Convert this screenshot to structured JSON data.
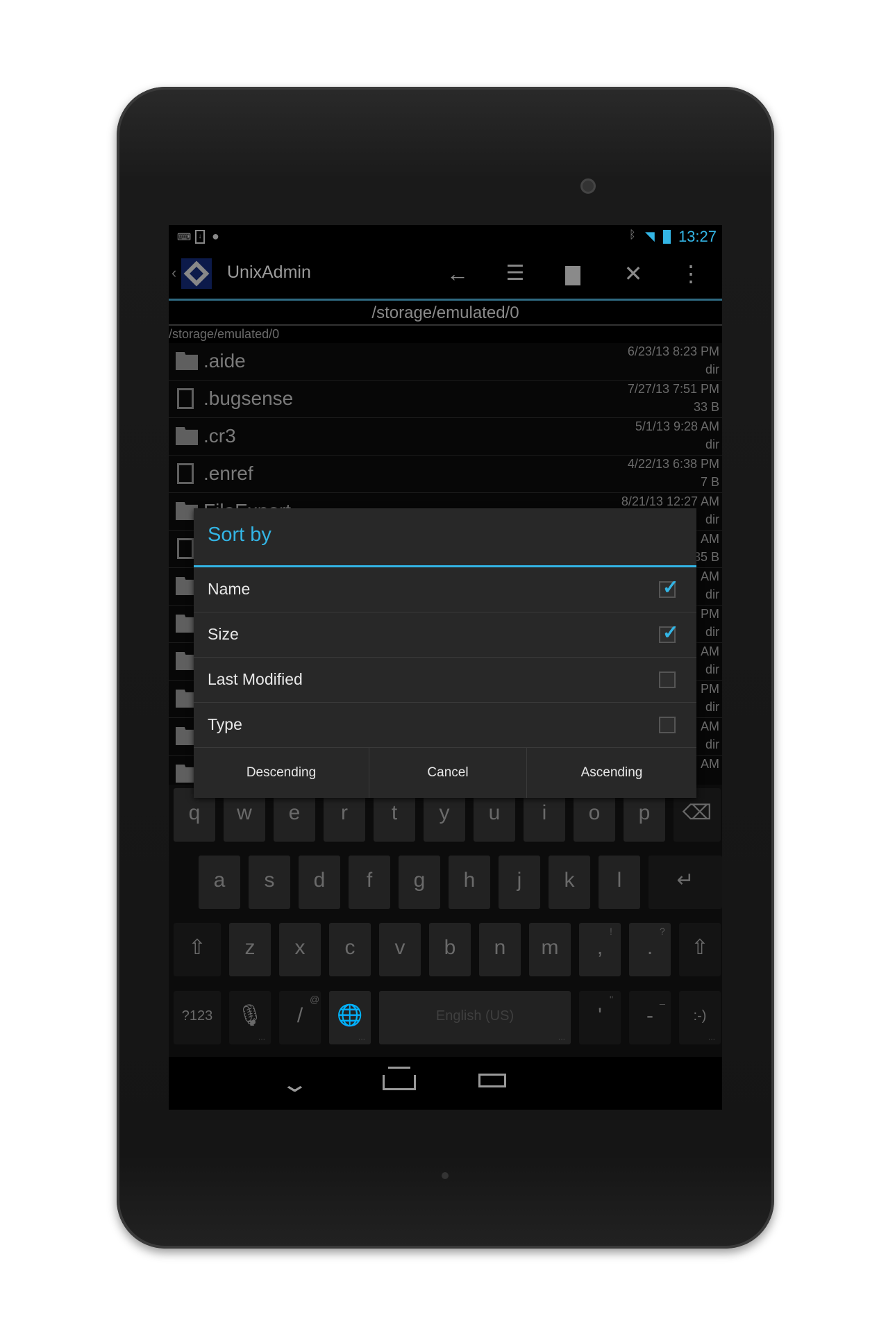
{
  "status_bar": {
    "time": "13:27",
    "left_icons": [
      "keyboard-icon",
      "download-icon",
      "android-icon"
    ],
    "right_icons": [
      "bluetooth-icon",
      "wifi-icon",
      "battery-charging-icon"
    ]
  },
  "action_bar": {
    "title": "UnixAdmin",
    "actions": [
      "back-arrow-icon",
      "sort-icon",
      "new-file-icon",
      "close-icon",
      "overflow-menu-icon"
    ]
  },
  "path_header": "/storage/emulated/0",
  "breadcrumb_path": "/storage/emulated/0",
  "files": [
    {
      "name": ".aide",
      "type": "folder",
      "date": "6/23/13 8:23 PM",
      "size": "dir"
    },
    {
      "name": ".bugsense",
      "type": "file",
      "date": "7/27/13 7:51 PM",
      "size": "33 B"
    },
    {
      "name": ".cr3",
      "type": "folder",
      "date": "5/1/13 9:28 AM",
      "size": "dir"
    },
    {
      "name": ".enref",
      "type": "file",
      "date": "4/22/13 6:38 PM",
      "size": "7 B"
    },
    {
      "name": "FileExpert",
      "type": "folder",
      "date": "8/21/13 12:27 AM",
      "size": "dir"
    },
    {
      "name": "",
      "type": "file",
      "date": "AM",
      "size": "35 B"
    },
    {
      "name": "",
      "type": "folder",
      "date": "AM",
      "size": "dir"
    },
    {
      "name": "",
      "type": "folder",
      "date": "PM",
      "size": "dir"
    },
    {
      "name": "",
      "type": "folder",
      "date": "AM",
      "size": "dir"
    },
    {
      "name": "",
      "type": "folder",
      "date": "PM",
      "size": "dir"
    },
    {
      "name": "",
      "type": "folder",
      "date": "AM",
      "size": "dir"
    },
    {
      "name": "",
      "type": "folder",
      "date": "AM",
      "size": ""
    }
  ],
  "dialog": {
    "title": "Sort by",
    "options": [
      {
        "label": "Name",
        "checked": true
      },
      {
        "label": "Size",
        "checked": true
      },
      {
        "label": "Last Modified",
        "checked": false
      },
      {
        "label": "Type",
        "checked": false
      }
    ],
    "buttons": {
      "descending": "Descending",
      "cancel": "Cancel",
      "ascending": "Ascending"
    }
  },
  "keyboard": {
    "row1": [
      "q",
      "w",
      "e",
      "r",
      "t",
      "y",
      "u",
      "i",
      "o",
      "p"
    ],
    "row2": [
      "a",
      "s",
      "d",
      "f",
      "g",
      "h",
      "j",
      "k",
      "l"
    ],
    "row3": [
      "z",
      "x",
      "c",
      "v",
      "b",
      "n",
      "m",
      ",",
      "."
    ],
    "row3_hints": [
      "",
      "",
      "",
      "",
      "",
      "",
      "",
      "!",
      "?"
    ],
    "symbols_key": "?123",
    "slash_key": "/",
    "slash_hint": "@",
    "space_label": "English (US)",
    "apostrophe_key": "'",
    "apostrophe_hint": "\"",
    "dash_key": "-",
    "dash_hint": "_",
    "smiley_key": ":-)"
  },
  "colors": {
    "accent": "#33b5e5"
  }
}
